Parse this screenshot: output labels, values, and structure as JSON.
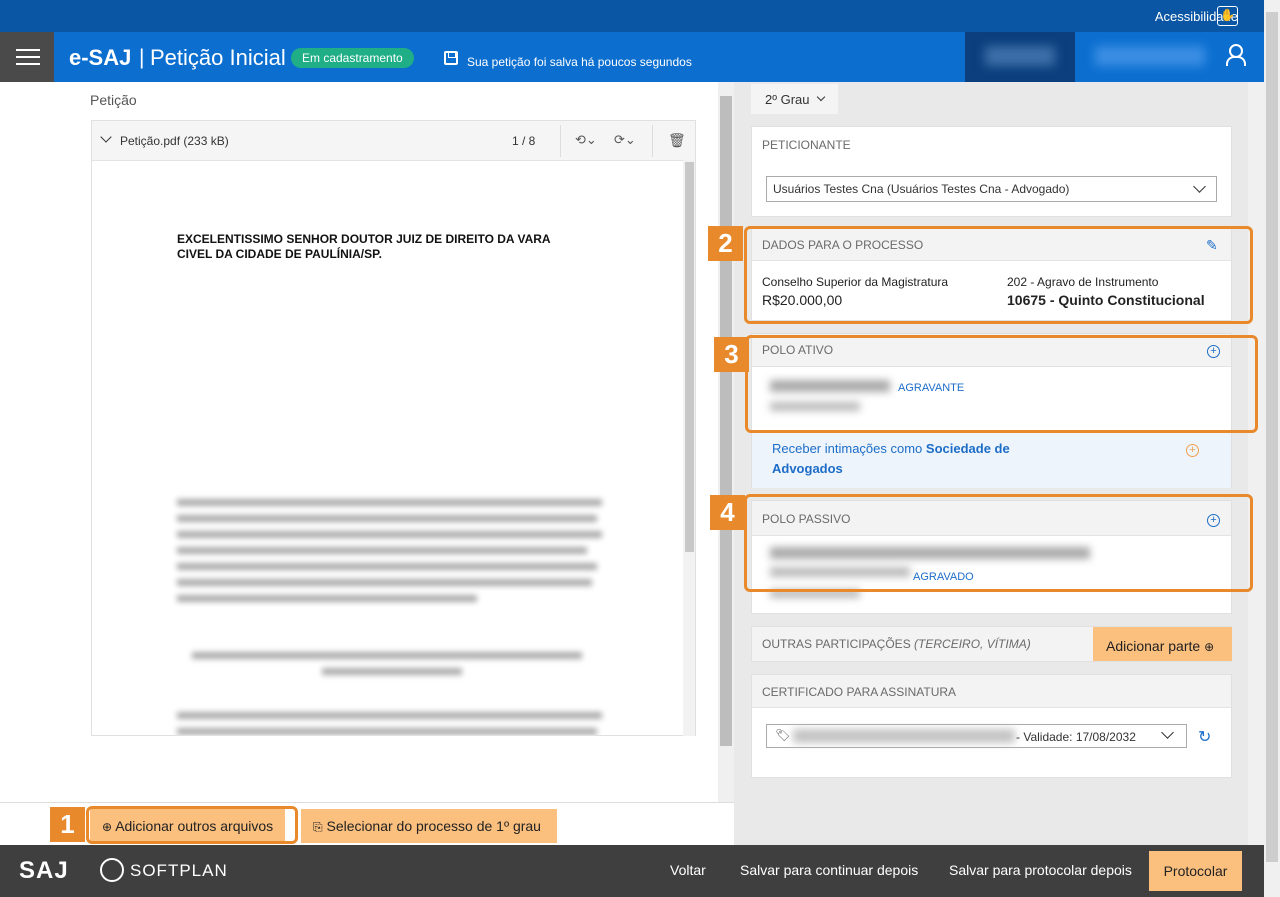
{
  "topbar": {
    "accessibility_label": "Acessibilidade",
    "accessibility_icon": "hand-icon"
  },
  "header": {
    "brand": "e-SAJ",
    "separator": "|",
    "title": "Petição Inicial",
    "status_badge": "Em cadastramento",
    "save_status": "Sua petição foi salva há poucos segundos",
    "accent_color": "#0c6fd0"
  },
  "left": {
    "section_label": "Petição",
    "file": {
      "name": "Petição.pdf (233 kB)",
      "page_counter": "1 / 8"
    },
    "document": {
      "heading_line1": "EXCELENTISSIMO SENHOR DOUTOR JUIZ DE DIREITO DA      VARA",
      "heading_line2": "CIVEL DA CIDADE DE PAULÍNIA/SP."
    },
    "buttons": {
      "add_files": "Adicionar outros arquivos",
      "select_process": "Selecionar do processo de 1º grau"
    }
  },
  "right": {
    "grau": "2º Grau",
    "peticionante": {
      "title": "PETICIONANTE",
      "selected": "Usuários Testes Cna (Usuários Testes Cna - Advogado)"
    },
    "dados": {
      "title": "DADOS PARA O PROCESSO",
      "orgao": "Conselho Superior da Magistratura",
      "valor": "R$20.000,00",
      "classe": "202 - Agravo de Instrumento",
      "assunto": "10675 - Quinto Constitucional"
    },
    "polo_ativo": {
      "title": "POLO ATIVO",
      "role": "AGRAVANTE"
    },
    "intimacoes": {
      "text": "Receber intimações como ",
      "link": "Sociedade de Advogados"
    },
    "polo_passivo": {
      "title": "POLO PASSIVO",
      "role": "AGRAVADO"
    },
    "outras": {
      "title": "OUTRAS PARTICIPAÇÕES",
      "subtitle": "(TERCEIRO, VÍTIMA)",
      "button": "Adicionar parte"
    },
    "certificado": {
      "title": "CERTIFICADO PARA ASSINATURA",
      "validade": "- Validade: 17/08/2032"
    }
  },
  "annotations": {
    "n1": "1",
    "n2": "2",
    "n3": "3",
    "n4": "4",
    "color": "#e8892b"
  },
  "footer": {
    "logo": "SAJ",
    "brand": "SOFTPLAN",
    "voltar": "Voltar",
    "salvar_continuar": "Salvar para continuar depois",
    "salvar_protocolar": "Salvar para protocolar depois",
    "protocolar": "Protocolar"
  }
}
